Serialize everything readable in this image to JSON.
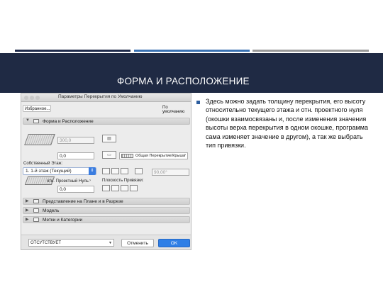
{
  "slide": {
    "title": "ФОРМА И РАСПОЛОЖЕНИЕ",
    "body": "Здесь можно задать толщину перекрытия, его высоту относительно текущего этажа и отн. проектного нуля (окошки взаимосвязаны и, после изменения значения высоты верха перекрытия в одном окошке, программа сама изменяет значение в другом), а так же выбрать тип привязки.",
    "colors": {
      "header_bg": "#1f2a44",
      "stripe_dark": "#1e2a4a",
      "stripe_blue": "#3a72b3",
      "stripe_gray": "#9a9a9a",
      "bullet": "#2b5d9e"
    }
  },
  "dialog": {
    "title": "Параметры Перекрытия по Умолчанию",
    "favorites_label": "Избранное...",
    "default_label": "По умолчанию",
    "section_shape": "Форма и Расположение",
    "thickness_value": "300,0",
    "offset_value": "0,0",
    "material_label": "Общая Перекрытие/Крыша",
    "home_story_label": "Собственный Этаж:",
    "home_story_value": "1. 1-й этаж (Текущий)",
    "angle_value": "90,00°",
    "project_zero_label": "отн. Проектный Нуль",
    "project_zero_value": "0,0",
    "reference_plane_label": "Плоскость Привязки:",
    "section_plan": "Представление на Плане и в Разрезе",
    "section_model": "Модель",
    "section_tags": "Метки и Категории",
    "layer_value": "ОТСУТСТВУЕТ",
    "cancel_label": "Отменить",
    "ok_label": "OK",
    "colors": {
      "ok_button": "#2f7fe6",
      "selector_blue": "#3b7de0"
    }
  }
}
